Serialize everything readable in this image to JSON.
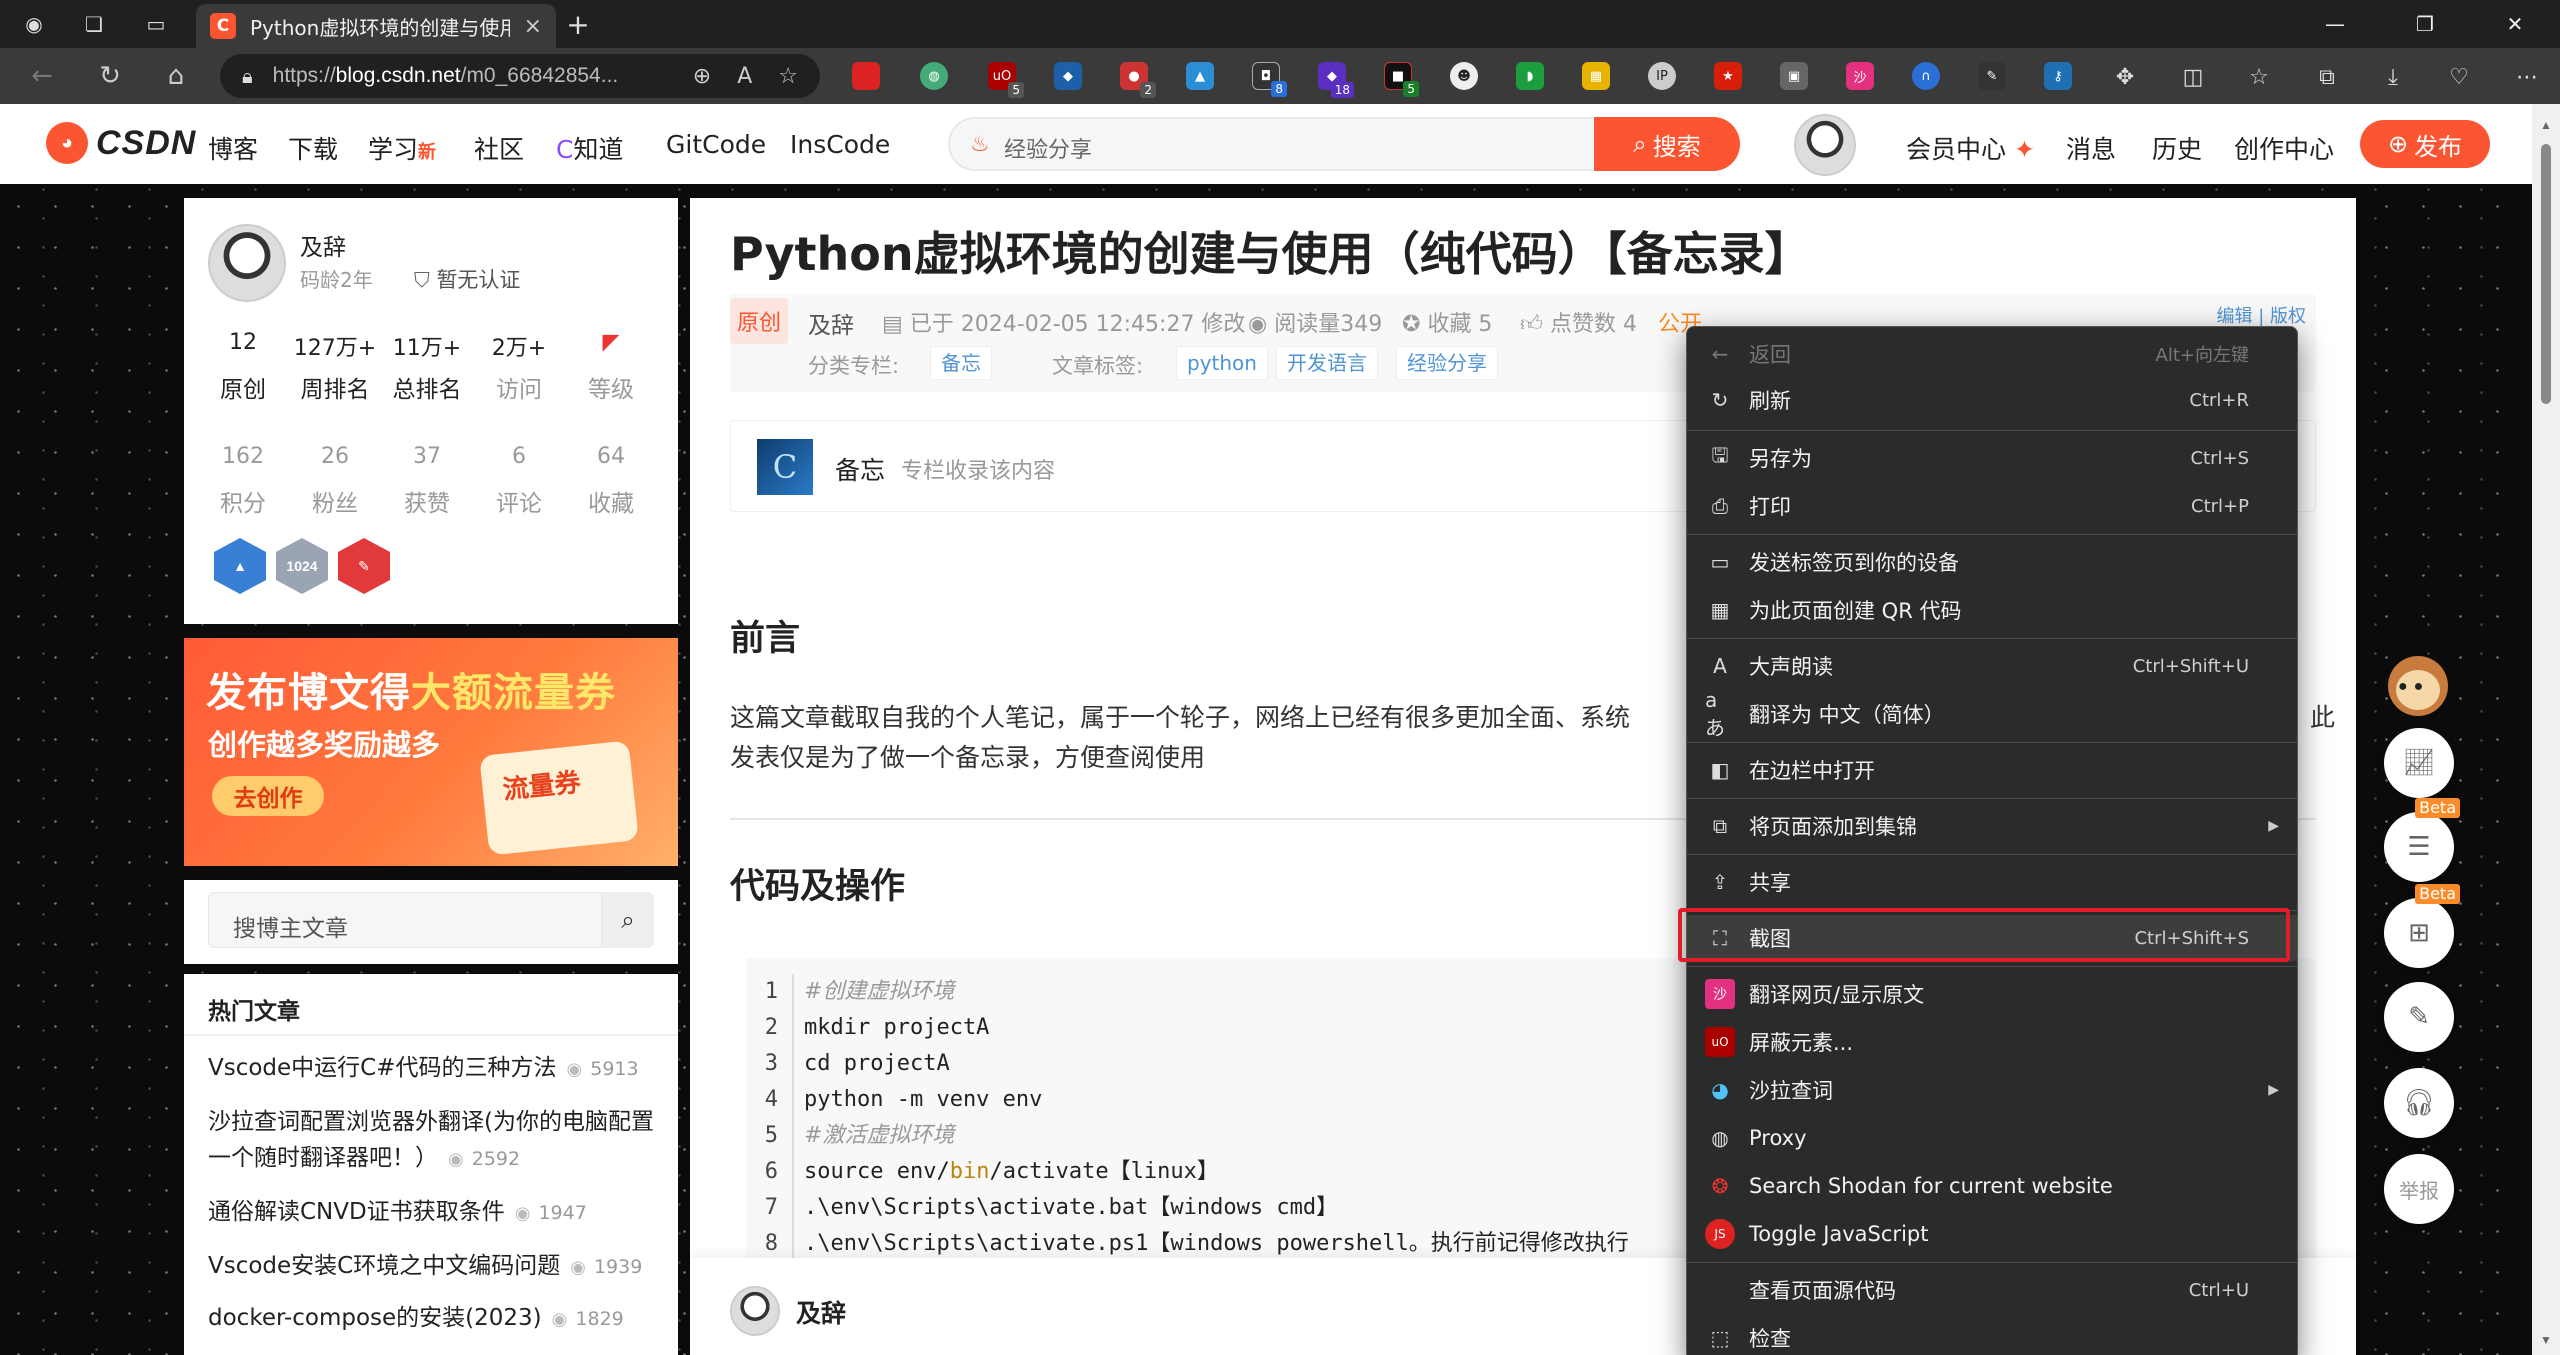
{
  "browser": {
    "tab_title": "Python虚拟环境的创建与使用（纯代",
    "tab_favicon": "C",
    "url_scheme": "https://",
    "url_host": "blog.csdn.net",
    "url_path": "/m0_66842854...",
    "tab_new": "+",
    "window_minimize": "—",
    "window_restore": "❐",
    "window_close": "✕",
    "extension_badges": [
      "5",
      "2",
      "8",
      "18",
      "5"
    ]
  },
  "header": {
    "logo_text": "CSDN",
    "nav": [
      "博客",
      "下载",
      "学习",
      "社区",
      "知道",
      "GitCode",
      "InsCode"
    ],
    "nav_new_badge": "新",
    "search_placeholder": "经验分享",
    "search_button": "搜索",
    "right_links": [
      "会员中心",
      "消息",
      "历史",
      "创作中心"
    ],
    "publish_button": "发布"
  },
  "profile": {
    "name": "及辞",
    "code_age": "码龄2年",
    "certification": "暂无认证",
    "stats_row1": [
      {
        "value": "12",
        "label": "原创"
      },
      {
        "value": "127万+",
        "label": "周排名"
      },
      {
        "value": "11万+",
        "label": "总排名"
      },
      {
        "value": "2万+",
        "label": "访问"
      },
      {
        "value": "",
        "label": "等级"
      }
    ],
    "stats_row2": [
      {
        "value": "162",
        "label": "积分"
      },
      {
        "value": "26",
        "label": "粉丝"
      },
      {
        "value": "37",
        "label": "获赞"
      },
      {
        "value": "6",
        "label": "评论"
      },
      {
        "value": "64",
        "label": "收藏"
      }
    ],
    "badge_1024": "1024"
  },
  "banner": {
    "line1_a": "发布博文得",
    "line1_b": "大额流量券",
    "line2": "创作越多奖励越多",
    "button": "去创作",
    "coupon": "流量券"
  },
  "sidebar_search": {
    "placeholder": "搜博主文章"
  },
  "hot_articles": {
    "title": "热门文章",
    "items": [
      {
        "title": "Vscode中运行C#代码的三种方法",
        "views": "5913"
      },
      {
        "title": "沙拉查词配置浏览器外翻译(为你的电脑配置一个随时翻译器吧！）",
        "views": "2592"
      },
      {
        "title": "通俗解读CNVD证书获取条件",
        "views": "1947"
      },
      {
        "title": "Vscode安装C环境之中文编码问题",
        "views": "1939"
      },
      {
        "title": "docker-compose的安装(2023)",
        "views": "1829"
      }
    ]
  },
  "article": {
    "title": "Python虚拟环境的创建与使用（纯代码）【备忘录】",
    "original_tag": "原创",
    "author": "及辞",
    "modified": "已于 2024-02-05 12:45:27 修改",
    "reads": "阅读量349",
    "favorites": "收藏 5",
    "likes": "点赞数 4",
    "visibility": "公开",
    "category_label": "分类专栏:",
    "category": "备忘",
    "tags_label": "文章标签:",
    "tags": [
      "python",
      "开发语言",
      "经验分享"
    ],
    "edit_links": "编辑 | 版权",
    "column_icon": "C",
    "column_name": "备忘",
    "column_desc": "专栏收录该内容",
    "h_preface": "前言",
    "preface_text": "这篇文章截取自我的个人笔记，属于一个轮子，网络上已经有很多更加全面、系统",
    "preface_tail": "此",
    "preface_text2": "发表仅是为了做一个备忘录，方便查阅使用",
    "h_code": "代码及操作",
    "code": [
      {
        "n": "1",
        "comment": "#创建虚拟环境"
      },
      {
        "n": "2",
        "text": "mkdir projectA"
      },
      {
        "n": "3",
        "text": "cd projectA"
      },
      {
        "n": "4",
        "text": "python -m venv env"
      },
      {
        "n": "5",
        "comment": "#激活虚拟环境"
      },
      {
        "n": "6",
        "text_a": "source env/",
        "hl": "bin",
        "text_b": "/activate【linux】"
      },
      {
        "n": "7",
        "text": ".\\env\\Scripts\\activate.bat【windows cmd】"
      },
      {
        "n": "8",
        "text": ".\\env\\Scripts\\activate.ps1【windows powershell。执行前记得修改执行"
      }
    ],
    "bottom_author": "及辞"
  },
  "float_tools": {
    "beta": "Beta",
    "report": "举报"
  },
  "context_menu": {
    "items": [
      {
        "label": "返回",
        "shortcut": "Alt+向左键",
        "disabled": true
      },
      {
        "label": "刷新",
        "shortcut": "Ctrl+R"
      },
      {
        "label": "另存为",
        "shortcut": "Ctrl+S"
      },
      {
        "label": "打印",
        "shortcut": "Ctrl+P"
      },
      {
        "label": "发送标签页到你的设备",
        "shortcut": ""
      },
      {
        "label": "为此页面创建 QR 代码",
        "shortcut": ""
      },
      {
        "label": "大声朗读",
        "shortcut": "Ctrl+Shift+U"
      },
      {
        "label": "翻译为 中文（简体）",
        "shortcut": ""
      },
      {
        "label": "在边栏中打开",
        "shortcut": ""
      },
      {
        "label": "将页面添加到集锦",
        "shortcut": ""
      },
      {
        "label": "共享",
        "shortcut": ""
      },
      {
        "label": "截图",
        "shortcut": "Ctrl+Shift+S"
      },
      {
        "label": "翻译网页/显示原文",
        "shortcut": ""
      },
      {
        "label": "屏蔽元素...",
        "shortcut": ""
      },
      {
        "label": "沙拉查词",
        "shortcut": ""
      },
      {
        "label": "Proxy",
        "shortcut": ""
      },
      {
        "label": "Search Shodan for current website",
        "shortcut": ""
      },
      {
        "label": "Toggle JavaScript",
        "shortcut": ""
      },
      {
        "label": "查看页面源代码",
        "shortcut": "Ctrl+U"
      },
      {
        "label": "检查",
        "shortcut": ""
      }
    ],
    "highlight_color": "#e11d2a"
  },
  "colors": {
    "brand": "#fc5531",
    "menu_bg": "#2b2b2b",
    "tag_blue": "#5094d5"
  }
}
